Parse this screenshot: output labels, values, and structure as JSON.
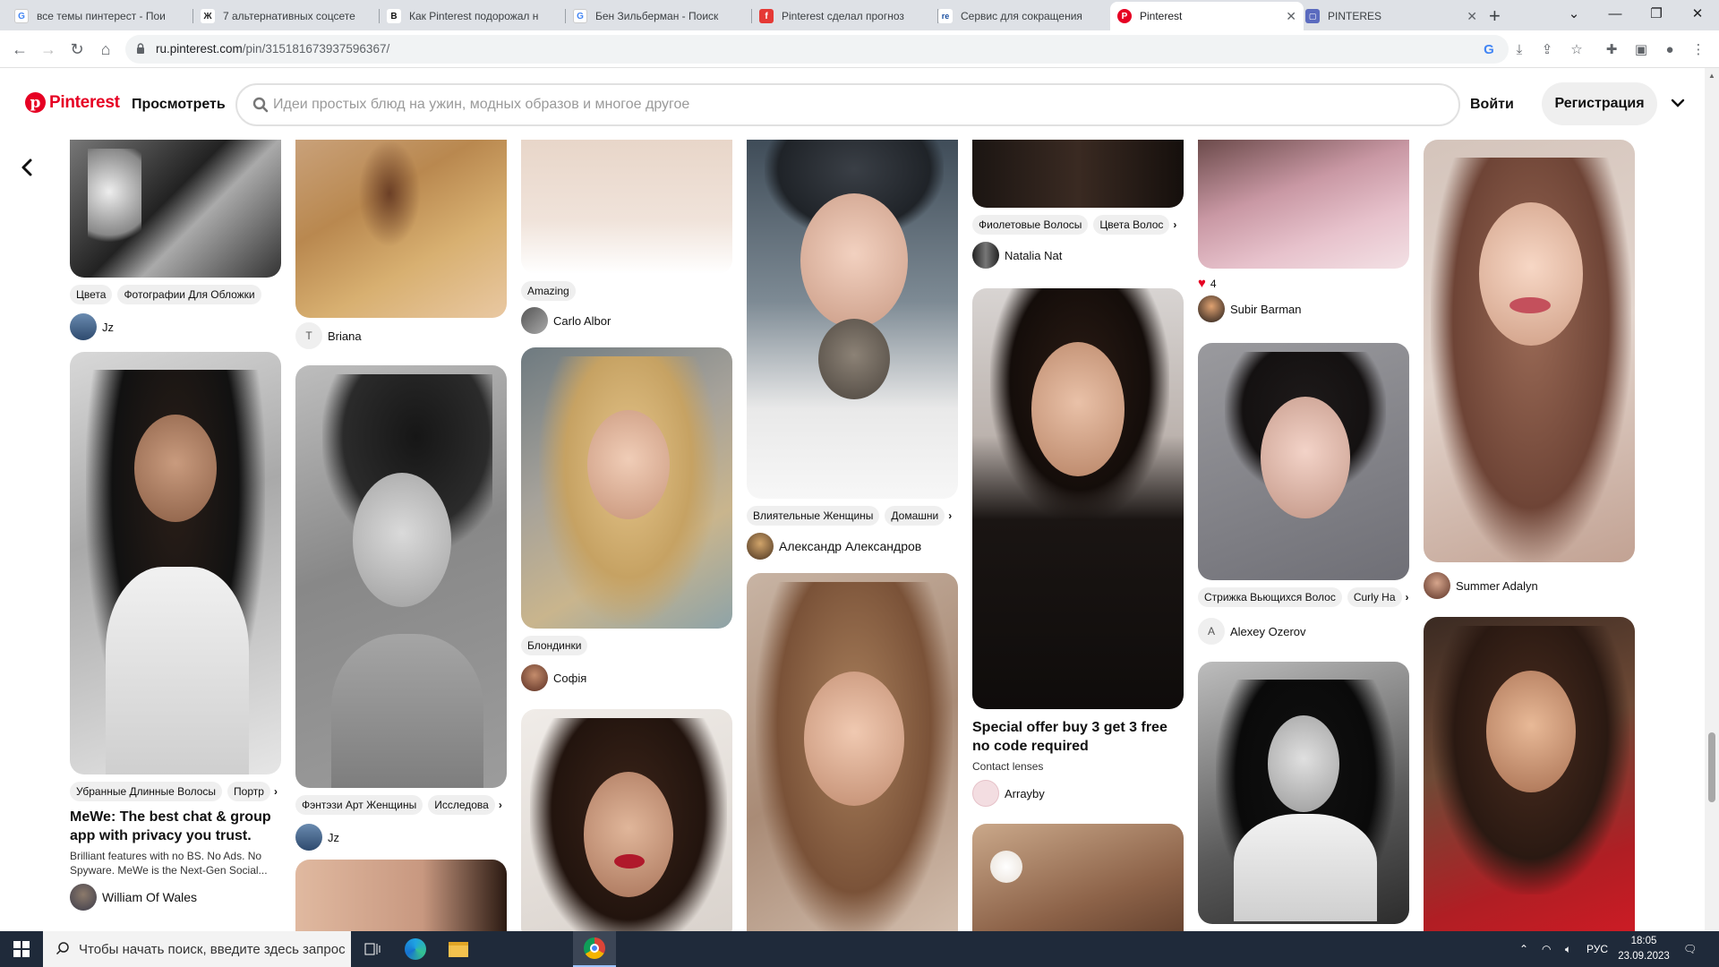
{
  "browser": {
    "tabs": [
      {
        "title": "все темы пинтерест - Пои",
        "favicon": "google-icon",
        "color": "#4285f4",
        "glyph": "G"
      },
      {
        "title": "7 альтернативных соцсете",
        "favicon": "site-icon",
        "color": "#222222",
        "glyph": "Ж"
      },
      {
        "title": "Как Pinterest подорожал н",
        "favicon": "b-icon",
        "color": "#111111",
        "glyph": "B"
      },
      {
        "title": "Бен Зильберман - Поиск",
        "favicon": "google-icon",
        "color": "#4285f4",
        "glyph": "G"
      },
      {
        "title": "Pinterest сделал прогноз",
        "favicon": "flag-icon",
        "color": "#e53935",
        "glyph": "f"
      },
      {
        "title": "Сервис для сокращения",
        "favicon": "re-icon",
        "color": "#1a4fa0",
        "glyph": "re"
      },
      {
        "title": "Pinterest",
        "favicon": "pinterest-icon",
        "color": "#e60023",
        "glyph": "P",
        "active": true
      },
      {
        "title": "PINTERES",
        "favicon": "doc-icon",
        "color": "#5b6bbf",
        "glyph": "▢"
      }
    ],
    "url_host": "ru.pinterest.com",
    "url_path": "/pin/315181673937596367/"
  },
  "header": {
    "logo_text": "Pinterest",
    "explore": "Просмотреть",
    "search_placeholder": "Идеи простых блюд на ужин, модных образов и многое другое",
    "login": "Войти",
    "signup": "Регистрация"
  },
  "pins": {
    "p1": {
      "chips": [
        "Цвета",
        "Фотографии Для Обложки"
      ],
      "owner": "Jz"
    },
    "p2": {
      "chips": [
        "Убранные Длинные Волосы",
        "Портр"
      ],
      "title": "MeWe: The best chat & group app with privacy you trust.",
      "desc": "Brilliant features with no BS. No Ads. No Spyware. MeWe is the Next-Gen Social...",
      "owner": "William Of Wales"
    },
    "p3": {
      "owner_initial": "T",
      "owner": "Briana"
    },
    "p4": {
      "chips": [
        "Фэнтэзи Арт Женщины",
        "Исследова"
      ],
      "owner": "Jz"
    },
    "p5": {
      "chips": [
        "Amazing"
      ],
      "owner": "Carlo Albor"
    },
    "p6": {
      "chips": [
        "Блондинки"
      ],
      "owner": "Софія"
    },
    "p7": {
      "chips": [
        "Влиятельные Женщины",
        "Домашни"
      ],
      "owner": "Александр Александров"
    },
    "p8": {
      "chips": [
        "Фиолетовые Волосы",
        "Цвета Волос"
      ],
      "owner": "Natalia Nat"
    },
    "p9": {
      "title": "Special offer buy 3 get 3 free no code required",
      "desc": "Contact lenses",
      "owner": "Arrayby"
    },
    "p10": {
      "likes": "4",
      "owner": "Subir Barman"
    },
    "p11": {
      "chips": [
        "Стрижка Вьющихся Волос",
        "Curly Ha"
      ],
      "owner_initial": "A",
      "owner": "Alexey Ozerov"
    },
    "p12": {
      "owner": "Summer Adalyn"
    }
  },
  "taskbar": {
    "search_placeholder": "Чтобы начать поиск, введите здесь запрос",
    "lang": "РУС",
    "time": "18:05",
    "date": "23.09.2023"
  },
  "colors": {
    "brand": "#e60023",
    "chip_bg": "#efefef",
    "taskbar_bg": "#1f2a3a"
  }
}
